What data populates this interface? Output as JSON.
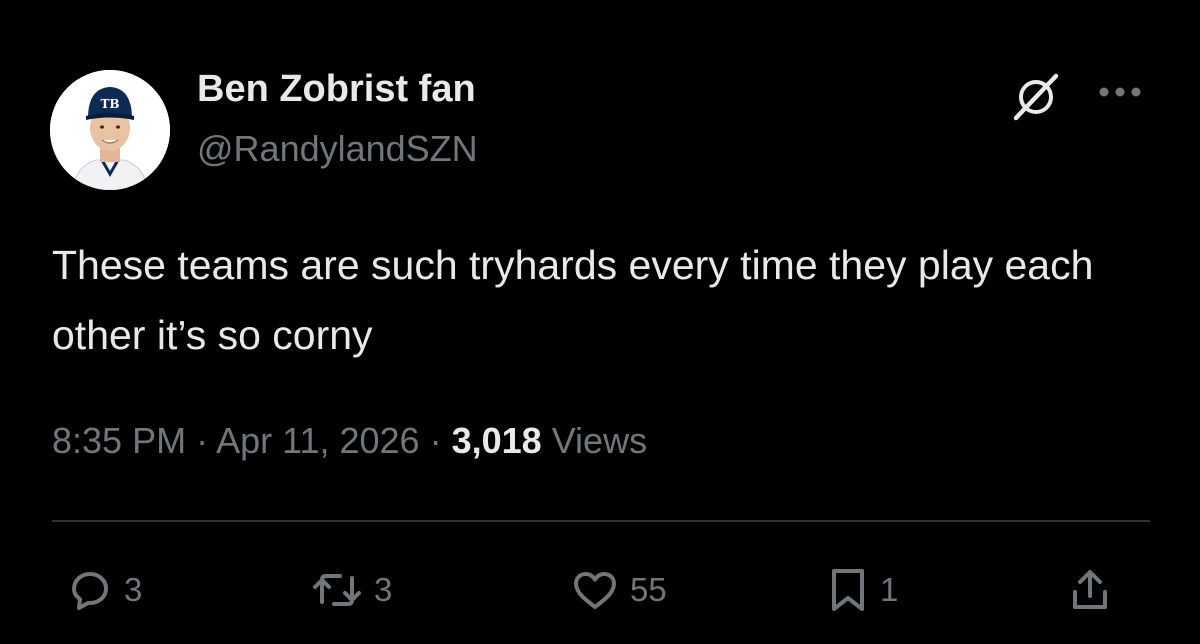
{
  "tweet": {
    "author": {
      "display_name": "Ben Zobrist fan",
      "handle": "@RandylandSZN",
      "avatar_cap_logo": "TB"
    },
    "text": "These teams are such tryhards every time they play each other it’s so corny",
    "meta": {
      "time": "8:35 PM",
      "separator": " · ",
      "date": "Apr 11, 2026",
      "views_count": "3,018",
      "views_label": "Views"
    },
    "icons": {
      "grok": "grok-icon",
      "more": "more-icon"
    },
    "actions": {
      "reply_count": "3",
      "retweet_count": "3",
      "like_count": "55",
      "bookmark_count": "1"
    }
  },
  "colors": {
    "background": "#000000",
    "primary_text": "#e7e9ea",
    "secondary_text": "#71767b",
    "divider": "#2f3336"
  }
}
